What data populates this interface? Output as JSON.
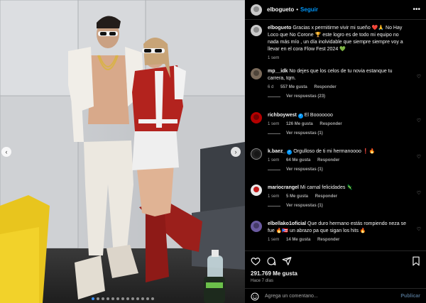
{
  "post": {
    "username": "elbogueto",
    "dot": "•",
    "follow_label": "Seguir",
    "more_icon": "more-horizontal-icon"
  },
  "photo": {
    "prev_icon": "‹",
    "next_icon": "›",
    "slides_total": 13,
    "slide_active": 1
  },
  "caption": {
    "username": "elbogueto",
    "text": "Gracias x permitirme vivir mi sueño ❤️🙏 No Hay Loco que No Corone 🏆 este logro es de todo mi equipo no nada más mío , un día inolvidable que siempre siempre voy a llevar en el cora Flow Fest 2024 💚",
    "time": "1 sem"
  },
  "comments": [
    {
      "username": "mp__idk",
      "verified": false,
      "text": "No dejes que los celos de tu novia estanque tu carrera, tqm.",
      "time": "6 d",
      "likes": "557 Me gusta",
      "reply": "Responder",
      "replies": "Ver respuestas (23)"
    },
    {
      "username": "richboywest",
      "verified": true,
      "text": "El Booooooo",
      "time": "1 sem",
      "likes": "126 Me gusta",
      "reply": "Responder",
      "replies": "Ver respuestas (1)"
    },
    {
      "username": "k.baez_",
      "verified": true,
      "text": "Orgulloso de ti mi hermanoooo ❗🔥",
      "time": "1 sem",
      "likes": "64 Me gusta",
      "reply": "Responder",
      "replies": "Ver respuestas (1)"
    },
    {
      "username": "mariocrangel",
      "verified": false,
      "text": "Mi carnal felicidades 🦎",
      "time": "1 sem",
      "likes": "5 Me gusta",
      "reply": "Responder",
      "replies": "Ver respuestas (1)"
    },
    {
      "username": "elbellako1oficial",
      "verified": false,
      "text": "Que duro hermano estás rompiendo neza se fue 🔥🇵🇷 un abrazo pa que sigan los hits 🔥",
      "time": "1 sem",
      "likes": "14 Me gusta",
      "reply": "Responder",
      "replies": ""
    }
  ],
  "footer": {
    "likes": "291.769 Me gusta",
    "time_ago": "Hace 7 días",
    "comment_placeholder": "Agrega un comentario...",
    "publish_label": "Publicar"
  },
  "colors": {
    "accent": "#0095f6",
    "background": "#000000",
    "muted_text": "#a8a8a8"
  }
}
